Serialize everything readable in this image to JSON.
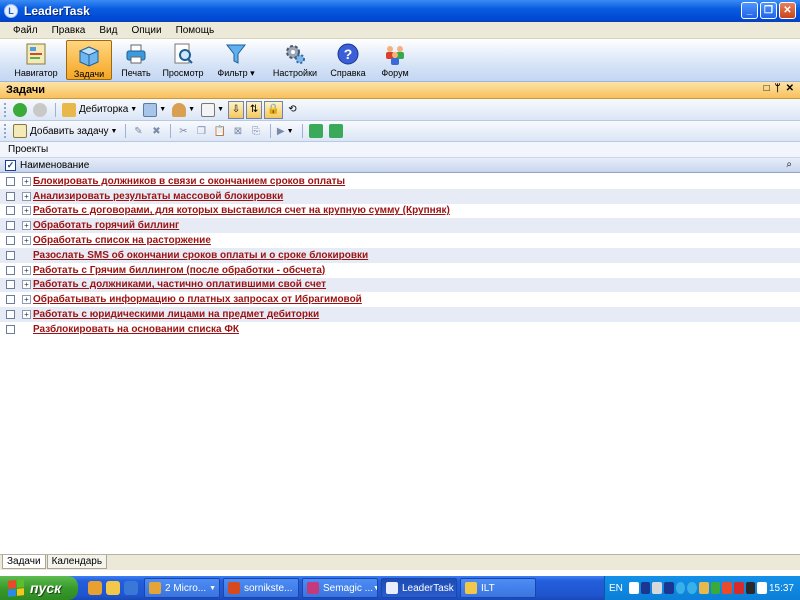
{
  "window": {
    "title": "LeaderTask",
    "app_icon_glyph": "L"
  },
  "menu": [
    "Файл",
    "Правка",
    "Вид",
    "Опции",
    "Помощь"
  ],
  "toolbar": {
    "buttons": [
      {
        "label": "Навигатор",
        "icon": "navigator-icon"
      },
      {
        "label": "Задачи",
        "icon": "tasks-box-icon",
        "active": true
      },
      {
        "label": "Печать",
        "icon": "printer-icon"
      },
      {
        "label": "Просмотр",
        "icon": "preview-icon"
      },
      {
        "label": "Фильтр",
        "icon": "funnel-filter-icon",
        "dropdown": true
      },
      {
        "label": "Настройки",
        "icon": "gears-settings-icon"
      },
      {
        "label": "Справка",
        "icon": "help-question-icon"
      },
      {
        "label": "Форум",
        "icon": "forum-people-icon"
      }
    ]
  },
  "panel": {
    "title": "Задачи"
  },
  "toolbar2": {
    "folder_label": "Дебиторка"
  },
  "toolbar3": {
    "add_task_label": "Добавить задачу"
  },
  "projects_label": "Проекты",
  "column_header": {
    "name_label": "Наименование"
  },
  "tasks": [
    {
      "text": "Блокировать должников в связи с окончанием сроков оплаты",
      "expandable": true
    },
    {
      "text": "Анализировать результаты массовой блокировки",
      "expandable": true
    },
    {
      "text": "Работать с договорами, для которых выставился счет на крупную сумму (Крупняк)",
      "expandable": true
    },
    {
      "text": "Обработать горячий биллинг",
      "expandable": true
    },
    {
      "text": "Обработать список на расторжение",
      "expandable": true
    },
    {
      "text": "Разослать SMS об окончании сроков оплаты и о сроке блокировки",
      "expandable": false
    },
    {
      "text": "Работать с Грячим биллингом (после обработки - обсчета)",
      "expandable": true
    },
    {
      "text": "Работать с должниками, частично оплатившими свой счет",
      "expandable": true
    },
    {
      "text": "Обрабатывать информацию о платных запросах от Ибрагимовой",
      "expandable": true
    },
    {
      "text": "Работать с юридическими лицами на предмет дебиторки",
      "expandable": true
    },
    {
      "text": "Разблокировать на основании списка ФК",
      "expandable": false
    }
  ],
  "bottom_tabs": [
    "Задачи",
    "Календарь"
  ],
  "taskbar": {
    "start_label": "пуск",
    "items": [
      {
        "label": "2 Micro...",
        "color": "#e3a43a",
        "dropdown": true
      },
      {
        "label": "sornikste...",
        "color": "#d64a1e",
        "dropdown": false
      },
      {
        "label": "Semagic ...",
        "color": "#c43a7a",
        "dropdown": true
      },
      {
        "label": "LeaderTask",
        "color": "#e8eefc",
        "dropdown": false,
        "active": true
      },
      {
        "label": "ILT",
        "color": "#f2c84b",
        "dropdown": false
      }
    ],
    "language": "EN",
    "clock": "15:37"
  }
}
